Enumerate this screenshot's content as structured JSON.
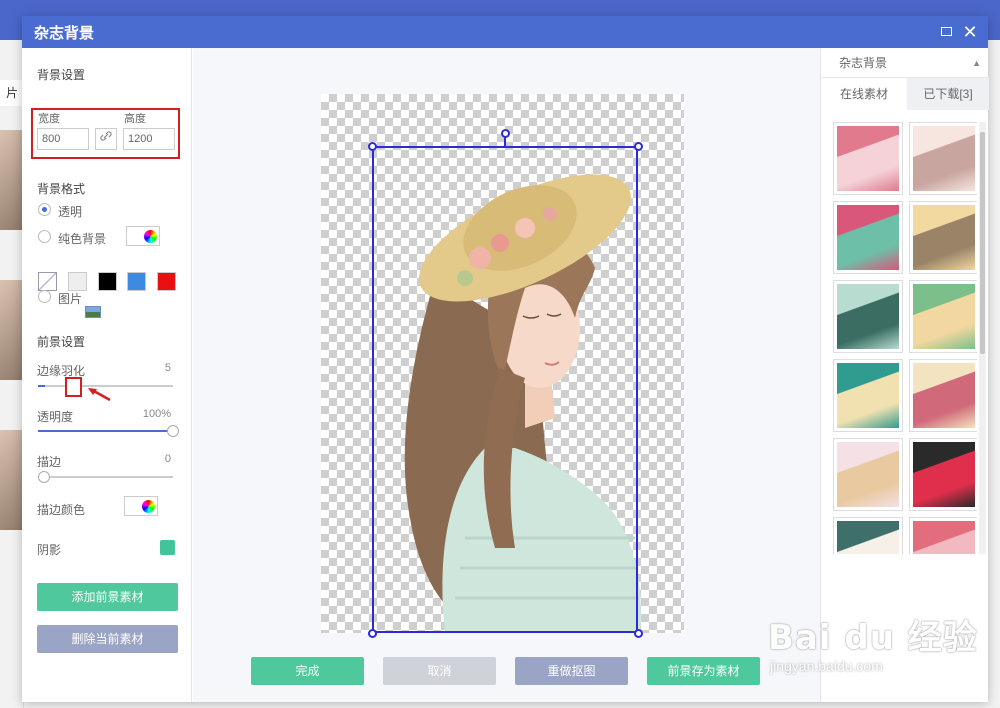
{
  "background_app": {
    "left_tab_label": "片"
  },
  "dialog": {
    "title": "杂志背景",
    "close_glyph": "✕"
  },
  "left_panel": {
    "bg_settings_title": "背景设置",
    "width_label": "宽度",
    "width_value": "800",
    "height_label": "高度",
    "height_value": "1200",
    "bg_format_title": "背景格式",
    "options": {
      "transparent": "透明",
      "solid": "纯色背景",
      "image": "图片"
    },
    "swatches": [
      "#eeeeee",
      "#000000",
      "#3d8be0",
      "#e81010"
    ],
    "fg_settings_title": "前景设置",
    "feather_label": "边缘羽化",
    "feather_value": "5",
    "feather_level": 5,
    "opacity_label": "透明度",
    "opacity_value": "100%",
    "opacity_level": 100,
    "stroke_label": "描边",
    "stroke_value": "0",
    "stroke_color_label": "描边颜色",
    "shadow_label": "阴影",
    "add_fg_button": "添加前景素材",
    "delete_fg_button": "删除当前素材"
  },
  "canvas_buttons": {
    "done": "完成",
    "cancel": "取消",
    "redo_cutout": "重做抠图",
    "save_fg": "前景存为素材"
  },
  "right_panel": {
    "category": "杂志背景",
    "tab_online": "在线素材",
    "tab_downloaded": "已下载[3]",
    "thumbnails": [
      {
        "c1": "#e07a8c",
        "c2": "#f4d2d8"
      },
      {
        "c1": "#f7e6e0",
        "c2": "#c9a5a0"
      },
      {
        "c1": "#d9587a",
        "c2": "#6dbfa8"
      },
      {
        "c1": "#f2d9a0",
        "c2": "#9a8468"
      },
      {
        "c1": "#b8dccf",
        "c2": "#3b6d62"
      },
      {
        "c1": "#7cbf8a",
        "c2": "#f2d7a0"
      },
      {
        "c1": "#2f9c8f",
        "c2": "#f1e1b0"
      },
      {
        "c1": "#f3e3c0",
        "c2": "#d06a7a"
      },
      {
        "c1": "#f4e0e5",
        "c2": "#e8c9a0"
      },
      {
        "c1": "#2a2a2a",
        "c2": "#e02f4c"
      },
      {
        "c1": "#3f6f6a",
        "c2": "#f6f0e8"
      },
      {
        "c1": "#e26d7c",
        "c2": "#f2b9c0"
      }
    ]
  },
  "watermark": {
    "brand": "Bai du 经验",
    "url": "jingyan.baidu.com"
  }
}
